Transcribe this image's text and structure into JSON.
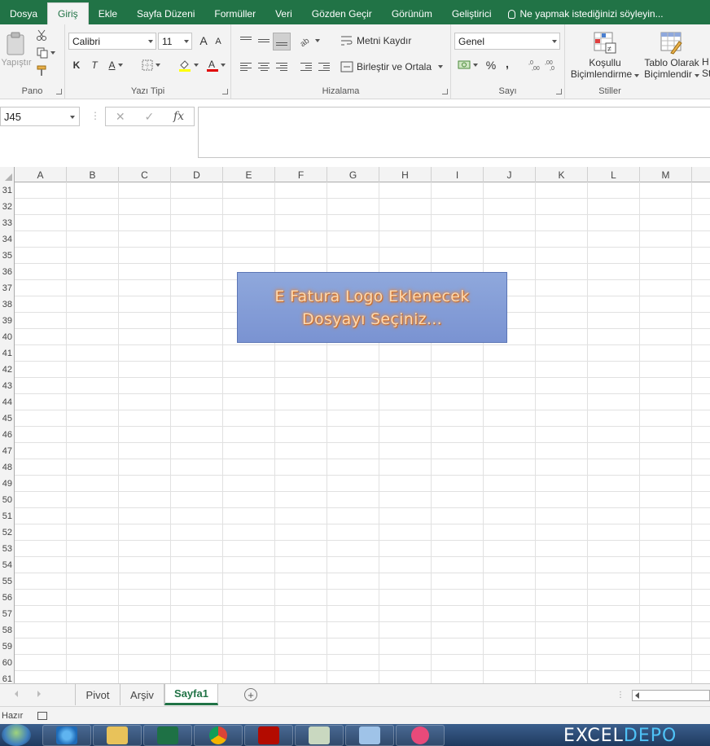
{
  "tabs": [
    "Dosya",
    "Giriş",
    "Ekle",
    "Sayfa Düzeni",
    "Formüller",
    "Veri",
    "Gözden Geçir",
    "Görünüm",
    "Geliştirici"
  ],
  "active_tab": "Giriş",
  "tell_me": "Ne yapmak istediğinizi söyleyin...",
  "ribbon": {
    "pano": {
      "label": "Pano",
      "paste": "Yapıştır"
    },
    "font": {
      "label": "Yazı Tipi",
      "name": "Calibri",
      "size": "11",
      "bold": "K",
      "italic": "T",
      "underline": "A",
      "grow": "A",
      "shrink": "A"
    },
    "align": {
      "label": "Hizalama",
      "wrap": "Metni Kaydır",
      "merge": "Birleştir ve Ortala"
    },
    "number": {
      "label": "Sayı",
      "format": "Genel",
      "percent": "%",
      "comma": ","
    },
    "styles": {
      "label": "Stiller",
      "cond1": "Koşullu",
      "cond2": "Biçimlendirme",
      "table1": "Tablo Olarak",
      "table2": "Biçimlendir",
      "cell1": "H",
      "cell2": "St"
    }
  },
  "formula": {
    "namebox": "J45",
    "fx": "fx",
    "cancel": "✕",
    "enter": "✓",
    "value": ""
  },
  "columns": [
    "A",
    "B",
    "C",
    "D",
    "E",
    "F",
    "G",
    "H",
    "I",
    "J",
    "K",
    "L",
    "M"
  ],
  "rows": [
    "31",
    "32",
    "33",
    "34",
    "35",
    "36",
    "37",
    "38",
    "39",
    "40",
    "41",
    "42",
    "43",
    "44",
    "45",
    "46",
    "47",
    "48",
    "49",
    "50",
    "51",
    "52",
    "53",
    "54",
    "55",
    "56",
    "57",
    "58",
    "59",
    "60",
    "61"
  ],
  "shape": {
    "line1": "E Fatura Logo Eklenecek",
    "line2": "Dosyayı Seçiniz..."
  },
  "sheets": [
    "Pivot",
    "Arşiv",
    "Sayfa1"
  ],
  "active_sheet": "Sayfa1",
  "status": "Hazır",
  "brand": {
    "a": "EXCEL",
    "b": "DEPO"
  }
}
